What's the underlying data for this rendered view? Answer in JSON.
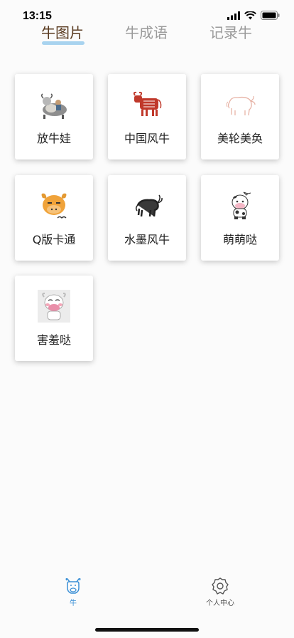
{
  "status_bar": {
    "time": "13:15"
  },
  "top_tabs": [
    {
      "label": "牛图片",
      "active": true
    },
    {
      "label": "牛成语",
      "active": false
    },
    {
      "label": "记录牛",
      "active": false
    }
  ],
  "categories": [
    {
      "label": "放牛娃",
      "icon": "cow-herding-boy-icon"
    },
    {
      "label": "中国风牛",
      "icon": "chinese-paper-cut-ox-icon"
    },
    {
      "label": "美轮美奂",
      "icon": "sketch-ox-icon"
    },
    {
      "label": "Q版卡通",
      "icon": "cartoon-ox-face-icon"
    },
    {
      "label": "水墨风牛",
      "icon": "ink-wash-ox-icon"
    },
    {
      "label": "萌萌哒",
      "icon": "cute-cow-icon"
    },
    {
      "label": "害羞哒",
      "icon": "shy-cow-icon"
    }
  ],
  "bottom_nav": [
    {
      "label": "牛",
      "icon": "cow-head-icon",
      "active": true
    },
    {
      "label": "个人中心",
      "icon": "settings-gear-icon",
      "active": false
    }
  ],
  "colors": {
    "active_tab_text": "#5a3b21",
    "tab_underline": "#a8d3ef",
    "nav_active": "#3a8fd6"
  }
}
